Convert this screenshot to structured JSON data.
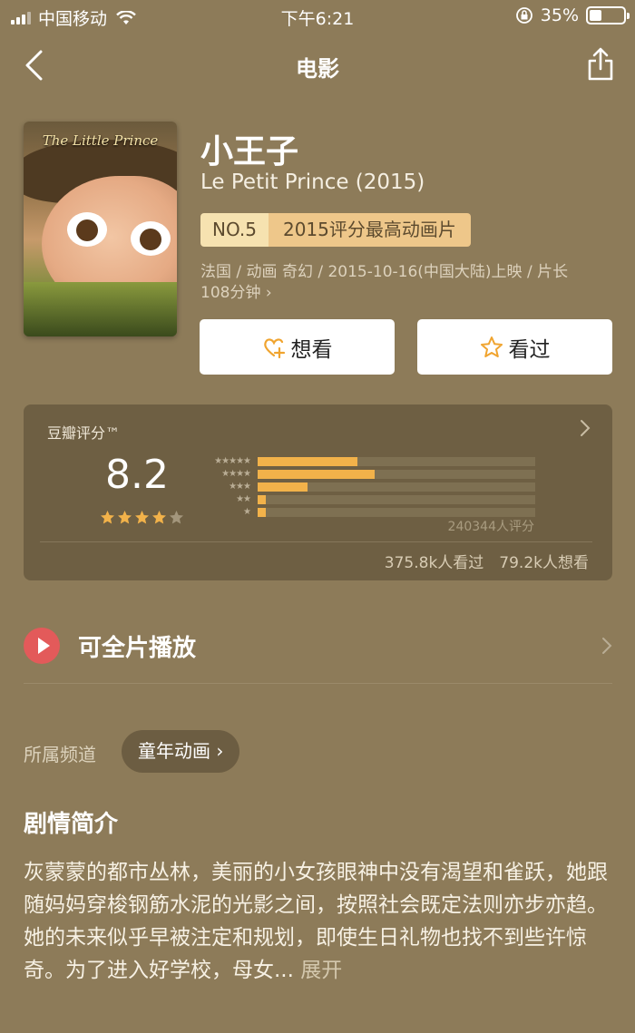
{
  "status": {
    "carrier": "中国移动",
    "time": "下午6:21",
    "battery": "35%",
    "battery_level": 0.35
  },
  "nav": {
    "title": "电影"
  },
  "movie": {
    "poster_title": "The Little Prince",
    "title": "小王子",
    "original_title": "Le Petit Prince (2015)",
    "rank_no": "NO.5",
    "rank_desc": "2015评分最高动画片",
    "meta_line1": "法国 / 动画 奇幻 / 2015-10-16(中国大陆)上映 / 片长",
    "meta_line2": "108分钟 ›"
  },
  "actions": {
    "want_label": "想看",
    "seen_label": "看过"
  },
  "rating": {
    "label": "豆瓣评分™",
    "score": "8.2",
    "stars": 4,
    "distribution": [
      {
        "stars": "★★★★★",
        "percent": 36
      },
      {
        "stars": "★★★★",
        "percent": 42
      },
      {
        "stars": "★★★",
        "percent": 18
      },
      {
        "stars": "★★",
        "percent": 3
      },
      {
        "stars": "★",
        "percent": 3
      }
    ],
    "count": "240344人评分",
    "stats": "375.8k人看过　79.2k人想看"
  },
  "play": {
    "label": "可全片播放"
  },
  "channel": {
    "label": "所属频道",
    "chip": "童年动画 ›"
  },
  "synopsis": {
    "title": "剧情简介",
    "text": "灰蒙蒙的都市丛林，美丽的小女孩眼神中没有渴望和雀跃，她跟随妈妈穿梭钢筋水泥的光影之间，按照社会既定法则亦步亦趋。她的未来似乎早被注定和规划，即使生日礼物也找不到些许惊奇。为了进入好学校，母女...",
    "more": " 展开"
  },
  "colors": {
    "background": "#8d7b59",
    "card": "#6e5f43",
    "bar": "#f2b24a",
    "badge": "#eec78a",
    "play": "#e35a5a"
  }
}
